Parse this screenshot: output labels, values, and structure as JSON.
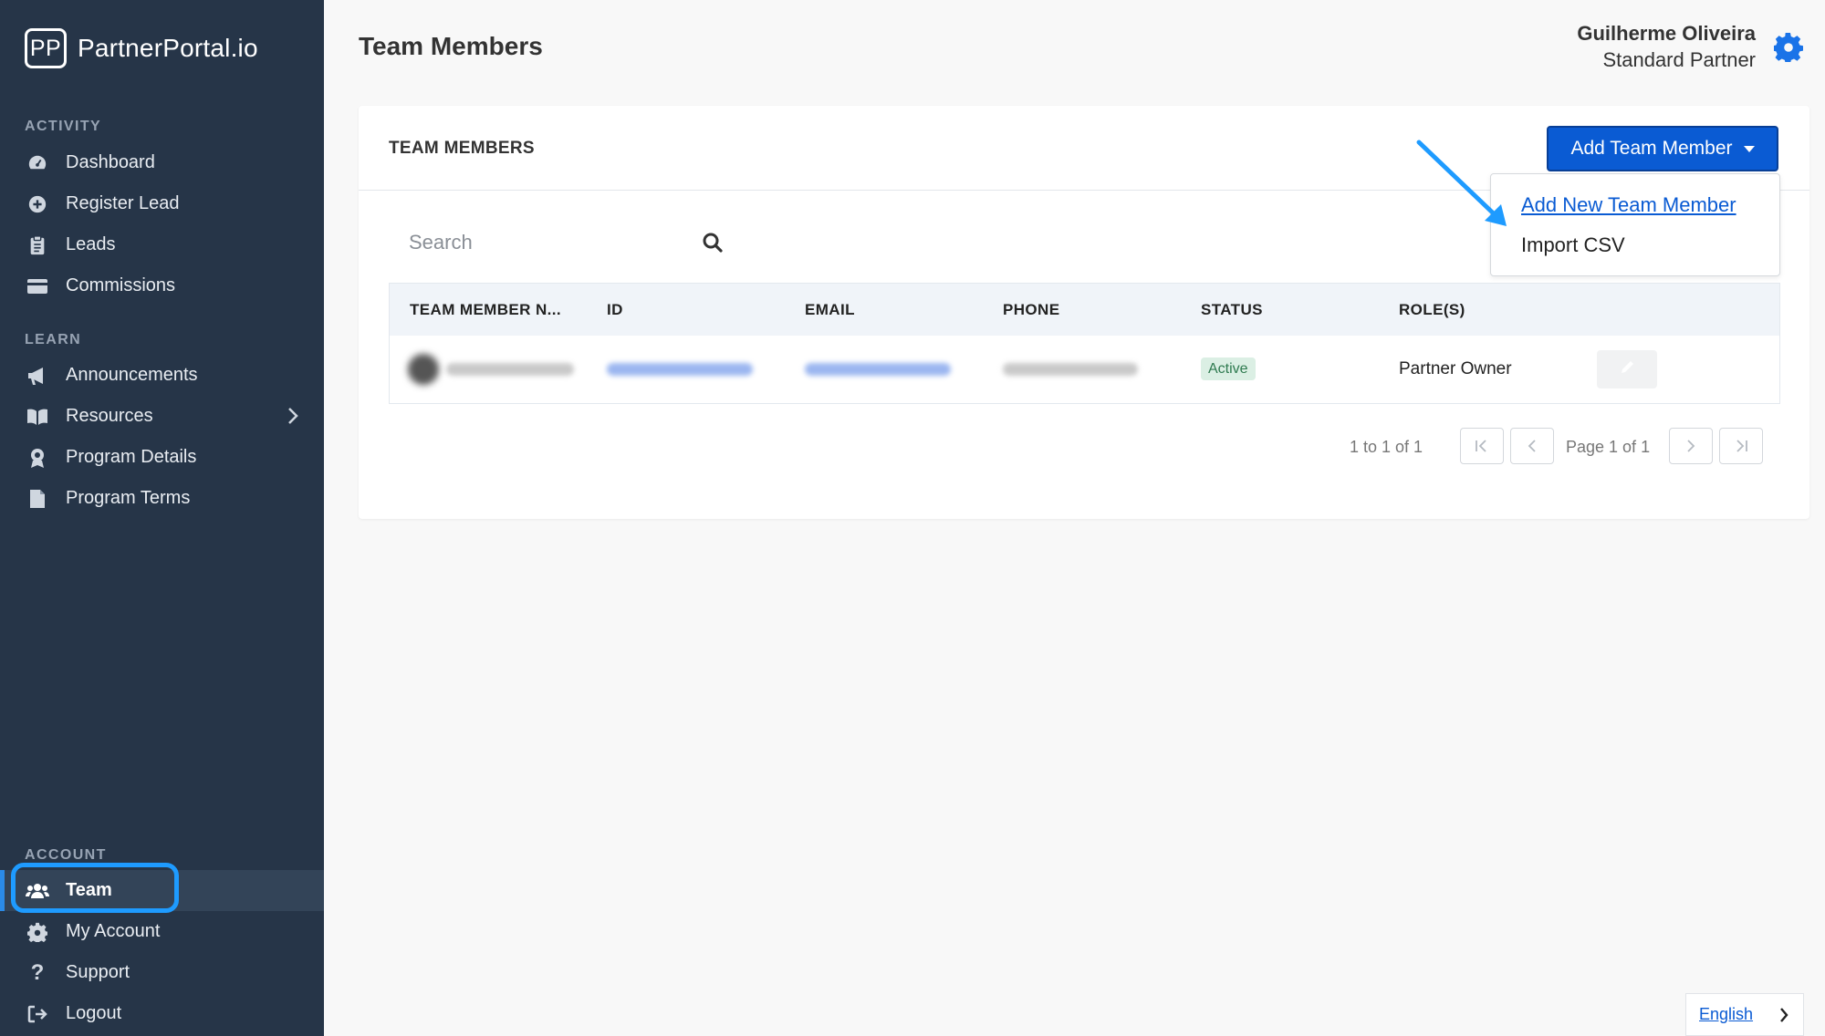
{
  "brand": {
    "mark": "PP",
    "name": "PartnerPortal.io"
  },
  "sidebar": {
    "sections": {
      "activity": "ACTIVITY",
      "learn": "LEARN",
      "account": "ACCOUNT"
    },
    "items": [
      {
        "label": "Dashboard",
        "icon": "dashboard-icon"
      },
      {
        "label": "Register Lead",
        "icon": "plus-circle-icon"
      },
      {
        "label": "Leads",
        "icon": "clipboard-icon"
      },
      {
        "label": "Commissions",
        "icon": "credit-card-icon"
      },
      {
        "label": "Announcements",
        "icon": "megaphone-icon"
      },
      {
        "label": "Resources",
        "icon": "book-icon"
      },
      {
        "label": "Program Details",
        "icon": "award-icon"
      },
      {
        "label": "Program Terms",
        "icon": "file-icon"
      },
      {
        "label": "Team",
        "icon": "users-icon",
        "active": true
      },
      {
        "label": "My Account",
        "icon": "gear-icon"
      },
      {
        "label": "Support",
        "icon": "question-icon"
      },
      {
        "label": "Logout",
        "icon": "logout-icon"
      }
    ]
  },
  "header": {
    "title": "Team Members",
    "user_name": "Guilherme Oliveira",
    "user_role": "Standard Partner"
  },
  "card": {
    "title": "TEAM MEMBERS",
    "add_button": "Add Team Member",
    "dropdown": [
      "Add New Team Member",
      "Import CSV"
    ],
    "search_placeholder": "Search",
    "columns": [
      "TEAM MEMBER N...",
      "ID",
      "EMAIL",
      "PHONE",
      "STATUS",
      "ROLE(S)"
    ],
    "rows": [
      {
        "status": "Active",
        "role": "Partner Owner"
      }
    ],
    "pagination": {
      "range": "1 to 1 of 1",
      "page": "Page 1 of 1"
    }
  },
  "footer": {
    "language": "English"
  },
  "colors": {
    "sidebar": "#263548",
    "primary": "#0a5bd3",
    "highlight": "#1e9bff",
    "active_badge": "#dbefe4"
  }
}
